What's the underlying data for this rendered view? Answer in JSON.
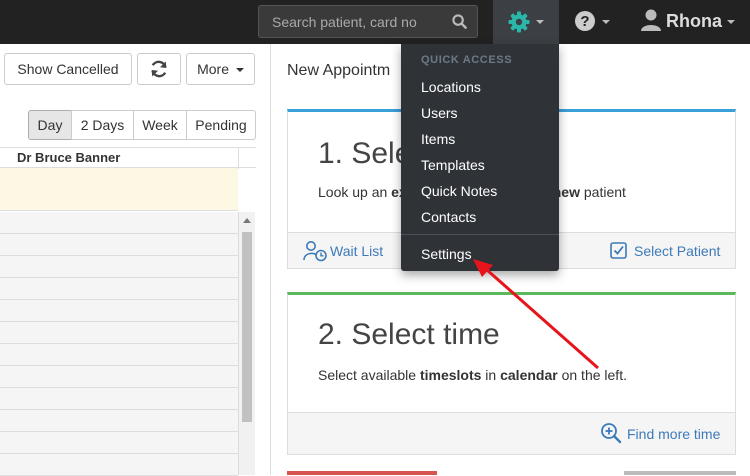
{
  "navbar": {
    "search_placeholder": "Search patient, card no",
    "user_name": "Rhona",
    "icons": {
      "search": "search-icon",
      "settings": "gear-icon",
      "help": "question-circle-icon",
      "user": "user-icon"
    },
    "accent_color": "#2ab7a9"
  },
  "toolbar": {
    "show_cancelled": "Show Cancelled",
    "more": "More"
  },
  "views": [
    "Day",
    "2 Days",
    "Week",
    "Pending"
  ],
  "active_view": "Day",
  "calendar": {
    "practitioner": "Dr Bruce Banner"
  },
  "main": {
    "title": "New Appointm",
    "step1": {
      "title": "1. Sele",
      "text_prefix": "Look up an ",
      "text_bold1": "ex",
      "text_bold2": "new",
      "text_suffix": " patient",
      "wait_list": "Wait List",
      "select_patient": "Select Patient"
    },
    "step2": {
      "title": "2. Select time",
      "text_prefix": "Select available ",
      "text_bold1": "timeslots",
      "text_mid": " in ",
      "text_bold2": "calendar",
      "text_suffix": " on the left.",
      "find_more": "Find more time"
    }
  },
  "dropdown": {
    "header": "QUICK ACCESS",
    "items": [
      "Locations",
      "Users",
      "Items",
      "Templates",
      "Quick Notes",
      "Contacts"
    ],
    "settings": "Settings"
  },
  "colors": {
    "step1": "#3aa0d8",
    "step2": "#5cb85c",
    "link": "#3d7ab8",
    "annotation": "#e8141b"
  }
}
